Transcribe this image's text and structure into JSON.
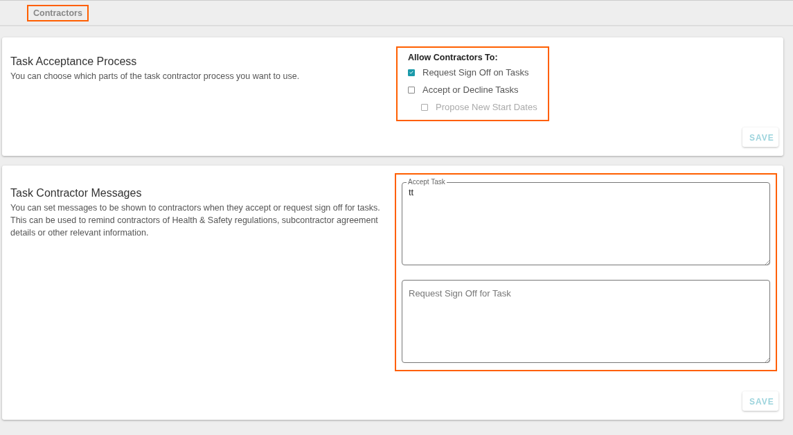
{
  "breadcrumb": {
    "label": "Contractors",
    "highlighted": true
  },
  "acceptance": {
    "title": "Task Acceptance Process",
    "description": "You can choose which parts of the task contractor process you want to use.",
    "options": {
      "heading": "Allow Contractors To:",
      "highlighted": true,
      "items": [
        {
          "label": "Request Sign Off on Tasks",
          "checked": true,
          "disabled": false
        },
        {
          "label": "Accept or Decline Tasks",
          "checked": false,
          "disabled": false,
          "children": [
            {
              "label": "Propose New Start Dates",
              "checked": false,
              "disabled": true
            }
          ]
        }
      ]
    },
    "save_button": {
      "label": "SAVE",
      "disabled": true
    }
  },
  "messages": {
    "title": "Task Contractor Messages",
    "description": "You can set messages to be shown to contractors when they accept or request sign off for tasks. This can be used to remind contractors of Health & Safety regulations, subcontractor agreement details or other relevant information.",
    "highlighted": true,
    "fields": [
      {
        "label": "Accept Task",
        "value": "tt"
      },
      {
        "placeholder": "Request Sign Off for Task"
      }
    ],
    "save_button": {
      "label": "SAVE",
      "disabled": true
    }
  }
}
